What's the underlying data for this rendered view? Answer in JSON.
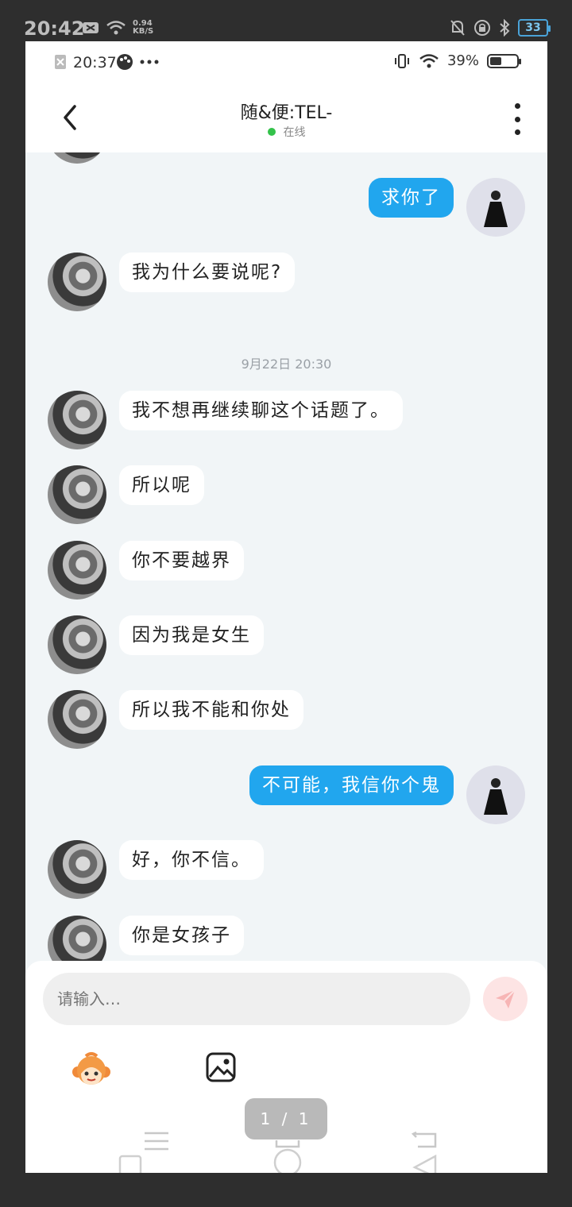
{
  "outer_status": {
    "time": "20:42",
    "net_speed_value": "0.94",
    "net_speed_unit": "KB/S",
    "battery": "33"
  },
  "inner_status": {
    "time": "20:37",
    "battery_pct": "39%"
  },
  "header": {
    "title": "随&便:TEL-",
    "status": "在线"
  },
  "messages": [
    {
      "side": "right",
      "text": "求你了"
    },
    {
      "side": "left",
      "text": "我为什么要说呢?"
    },
    {
      "type": "timestamp",
      "text": "9月22日 20:30"
    },
    {
      "side": "left",
      "text": "我不想再继续聊这个话题了。"
    },
    {
      "side": "left",
      "text": "所以呢"
    },
    {
      "side": "left",
      "text": "你不要越界"
    },
    {
      "side": "left",
      "text": "因为我是女生"
    },
    {
      "side": "left",
      "text": "所以我不能和你处"
    },
    {
      "side": "right",
      "text": "不可能，我信你个鬼"
    },
    {
      "side": "left",
      "text": "好，你不信。"
    },
    {
      "side": "left",
      "text": "你是女孩子"
    }
  ],
  "input": {
    "placeholder": "请输入…"
  },
  "page_indicator": "1 / 1",
  "colors": {
    "accent": "#21a6ee",
    "online": "#33c24a",
    "chat_bg": "#f1f5f7"
  }
}
